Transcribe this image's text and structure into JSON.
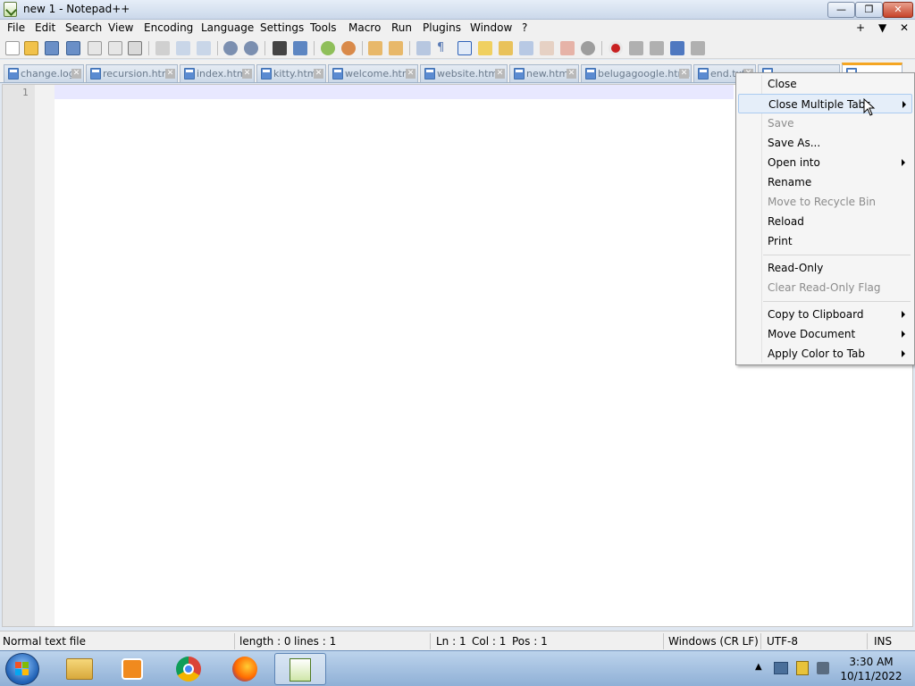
{
  "window": {
    "title": "new 1 - Notepad++",
    "min_label": "—",
    "max_label": "❐",
    "close_label": "✕"
  },
  "menu": {
    "items": [
      "File",
      "Edit",
      "Search",
      "View",
      "Encoding",
      "Language",
      "Settings",
      "Tools",
      "Macro",
      "Run",
      "Plugins",
      "Window",
      "?"
    ],
    "right": [
      "+",
      "▼",
      "✕"
    ]
  },
  "tabs": [
    {
      "label": "change.log"
    },
    {
      "label": "recursion.html"
    },
    {
      "label": "index.html"
    },
    {
      "label": "kitty.htm"
    },
    {
      "label": "welcome.html"
    },
    {
      "label": "website.html"
    },
    {
      "label": "new.htm"
    },
    {
      "label": "belugagoogle.html"
    },
    {
      "label": "end.txt"
    }
  ],
  "editor": {
    "line_numbers": [
      "1"
    ]
  },
  "context_menu": {
    "items": [
      {
        "label": "Close",
        "enabled": true,
        "submenu": false
      },
      {
        "label": "Close Multiple Tabs",
        "enabled": true,
        "submenu": true,
        "highlighted": true
      },
      {
        "label": "Save",
        "enabled": false,
        "submenu": false
      },
      {
        "label": "Save As...",
        "enabled": true,
        "submenu": false
      },
      {
        "label": "Open into",
        "enabled": true,
        "submenu": true
      },
      {
        "label": "Rename",
        "enabled": true,
        "submenu": false
      },
      {
        "label": "Move to Recycle Bin",
        "enabled": false,
        "submenu": false
      },
      {
        "label": "Reload",
        "enabled": true,
        "submenu": false
      },
      {
        "label": "Print",
        "enabled": true,
        "submenu": false
      },
      {
        "label": "Read-Only",
        "enabled": true,
        "submenu": false
      },
      {
        "label": "Clear Read-Only Flag",
        "enabled": false,
        "submenu": false
      },
      {
        "label": "Copy to Clipboard",
        "enabled": true,
        "submenu": true
      },
      {
        "label": "Move Document",
        "enabled": true,
        "submenu": true
      },
      {
        "label": "Apply Color to Tab",
        "enabled": true,
        "submenu": true
      }
    ]
  },
  "status": {
    "file_type": "Normal text file",
    "length": "length : 0",
    "lines": "lines : 1",
    "ln": "Ln : 1",
    "col": "Col : 1",
    "pos": "Pos : 1",
    "eol": "Windows (CR LF)",
    "encoding": "UTF-8",
    "mode": "INS"
  },
  "taskbar": {
    "apps": [
      "windows-explorer",
      "media-player",
      "chrome",
      "firefox",
      "notepad-plus-plus"
    ],
    "clock_time": "3:30 AM",
    "clock_date": "10/11/2022",
    "tray_arrow": "▲"
  }
}
